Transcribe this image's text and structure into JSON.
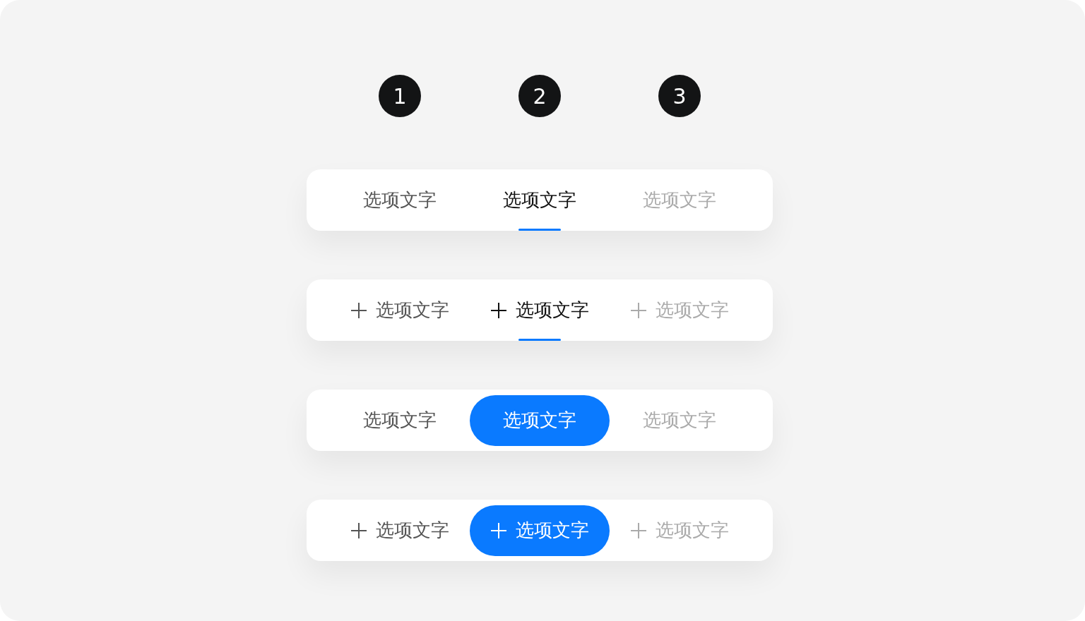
{
  "markers": [
    "1",
    "2",
    "3"
  ],
  "tab_bars": [
    {
      "kind": "underline",
      "has_icon": false,
      "tabs": [
        {
          "label": "选项文字",
          "selected": false,
          "disabled": false
        },
        {
          "label": "选项文字",
          "selected": true,
          "disabled": false
        },
        {
          "label": "选项文字",
          "selected": false,
          "disabled": true
        }
      ]
    },
    {
      "kind": "underline",
      "has_icon": true,
      "tabs": [
        {
          "label": "选项文字",
          "selected": false,
          "disabled": false
        },
        {
          "label": "选项文字",
          "selected": true,
          "disabled": false
        },
        {
          "label": "选项文字",
          "selected": false,
          "disabled": true
        }
      ]
    },
    {
      "kind": "pill",
      "has_icon": false,
      "tabs": [
        {
          "label": "选项文字",
          "selected": false,
          "disabled": false
        },
        {
          "label": "选项文字",
          "selected": true,
          "disabled": false
        },
        {
          "label": "选项文字",
          "selected": false,
          "disabled": true
        }
      ]
    },
    {
      "kind": "pill",
      "has_icon": true,
      "tabs": [
        {
          "label": "选项文字",
          "selected": false,
          "disabled": false
        },
        {
          "label": "选项文字",
          "selected": true,
          "disabled": false
        },
        {
          "label": "选项文字",
          "selected": false,
          "disabled": true
        }
      ]
    }
  ]
}
